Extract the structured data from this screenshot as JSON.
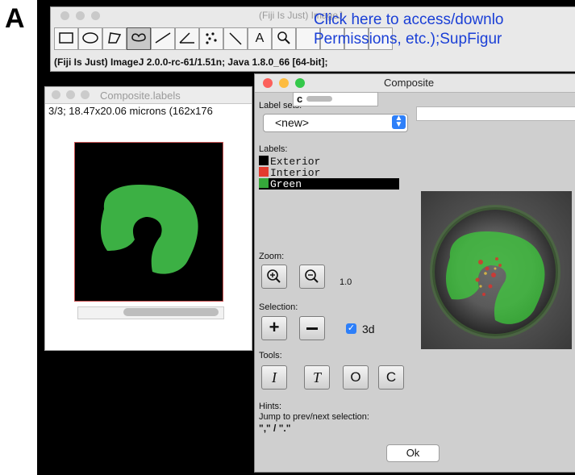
{
  "panel_label": "A",
  "imagej": {
    "title": "(Fiji Is Just) ImageJ",
    "status": "(Fiji Is Just) ImageJ 2.0.0-rc-61/1.51n; Java 1.8.0_66 [64-bit];",
    "overlay_link": {
      "line1": "Click here to access/downlo",
      "line2": "Permissions, etc.);SupFigur"
    },
    "tools": [
      "rectangle",
      "oval",
      "polygon",
      "freehand",
      "line",
      "angle",
      "multipoint",
      "wand",
      "text",
      "magnifier",
      "scroll",
      "color-picker",
      "more"
    ],
    "tool_glyphs": {
      "text": "A"
    }
  },
  "labels_window": {
    "title": "Composite.labels",
    "info": "3/3; 18.47x20.06 microns (162x176"
  },
  "composite": {
    "title": "Composite",
    "label_sets_label": "Label sets:",
    "label_set_value": "<new>",
    "c_field": "c",
    "labels_heading": "Labels:",
    "labels": [
      {
        "name": "Exterior",
        "color": "#000000",
        "selected": false
      },
      {
        "name": "Interior",
        "color": "#e23b2e",
        "selected": false
      },
      {
        "name": "Green",
        "color": "#35a83a",
        "selected": true
      }
    ],
    "zoom_label": "Zoom:",
    "zoom_value": "1.0",
    "selection_label": "Selection:",
    "selection_3d": "3d",
    "tools_label": "Tools:",
    "tool_buttons": [
      "I",
      "T",
      "O",
      "C"
    ],
    "hints_label": "Hints:",
    "hints_text": "Jump to prev/next selection:",
    "hints_keys": "\",\" / \".\"",
    "ok_label": "Ok"
  },
  "colors": {
    "accent": "#2d7ff9",
    "mask_green": "#3cb044",
    "link": "#1a3fd6"
  }
}
